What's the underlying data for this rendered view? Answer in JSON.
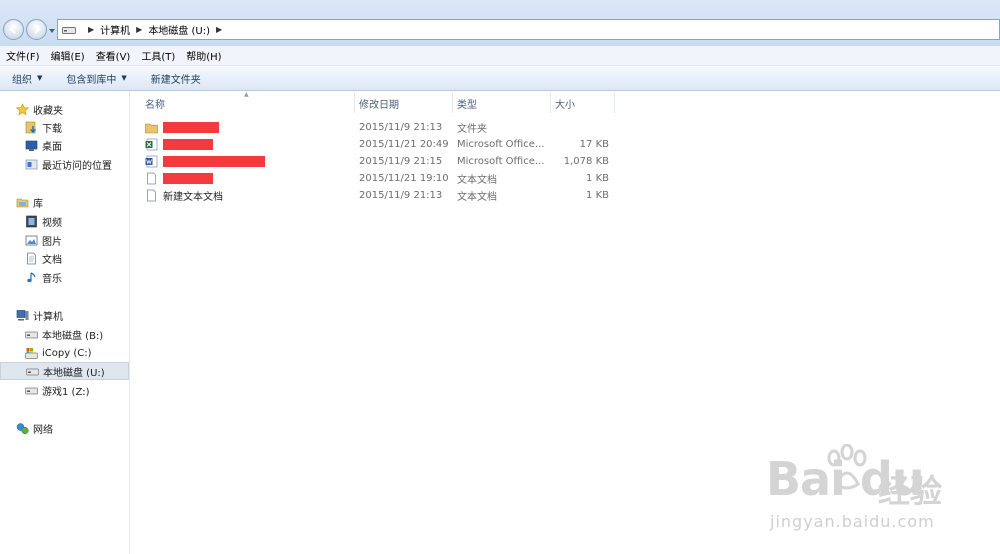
{
  "address": {
    "crumbs": [
      "计算机",
      "本地磁盘 (U:)"
    ]
  },
  "menu": [
    "文件(F)",
    "编辑(E)",
    "查看(V)",
    "工具(T)",
    "帮助(H)"
  ],
  "commands": [
    {
      "label": "组织",
      "dropdown": true
    },
    {
      "label": "包含到库中",
      "dropdown": true
    },
    {
      "label": "新建文件夹",
      "dropdown": false
    }
  ],
  "nav": {
    "favorites": {
      "label": "收藏夹",
      "items": [
        "下载",
        "桌面",
        "最近访问的位置"
      ]
    },
    "libraries": {
      "label": "库",
      "items": [
        "视频",
        "图片",
        "文档",
        "音乐"
      ]
    },
    "computer": {
      "label": "计算机",
      "items": [
        "本地磁盘 (B:)",
        "iCopy (C:)",
        "本地磁盘 (U:)",
        "游戏1 (Z:)"
      ],
      "selected_index": 2
    },
    "network": {
      "label": "网络"
    }
  },
  "columns": {
    "name": "名称",
    "date": "修改日期",
    "type": "类型",
    "size": "大小"
  },
  "files": [
    {
      "icon": "folder-icon",
      "name": "",
      "redacted": true,
      "date": "2015/11/9 21:13",
      "type": "文件夹",
      "size": ""
    },
    {
      "icon": "excel-icon",
      "name": "",
      "redacted": true,
      "date": "2015/11/21 20:49",
      "type": "Microsoft Office...",
      "size": "17 KB"
    },
    {
      "icon": "word-icon",
      "name": "",
      "redacted": true,
      "date": "2015/11/9 21:15",
      "type": "Microsoft Office...",
      "size": "1,078 KB"
    },
    {
      "icon": "text-file-icon",
      "name": "",
      "redacted": true,
      "date": "2015/11/21 19:10",
      "type": "文本文档",
      "size": "1 KB"
    },
    {
      "icon": "text-file-icon",
      "name": "新建文本文档",
      "redacted": false,
      "date": "2015/11/9 21:13",
      "type": "文本文档",
      "size": "1 KB"
    }
  ],
  "watermark": {
    "logo": "Bai du",
    "cn": "经验",
    "url": "jingyan.baidu.com"
  },
  "colors": {
    "redaction": "#f23a3f",
    "addr_bg": "#c9dcf2",
    "selection": "#dfe6ee"
  }
}
